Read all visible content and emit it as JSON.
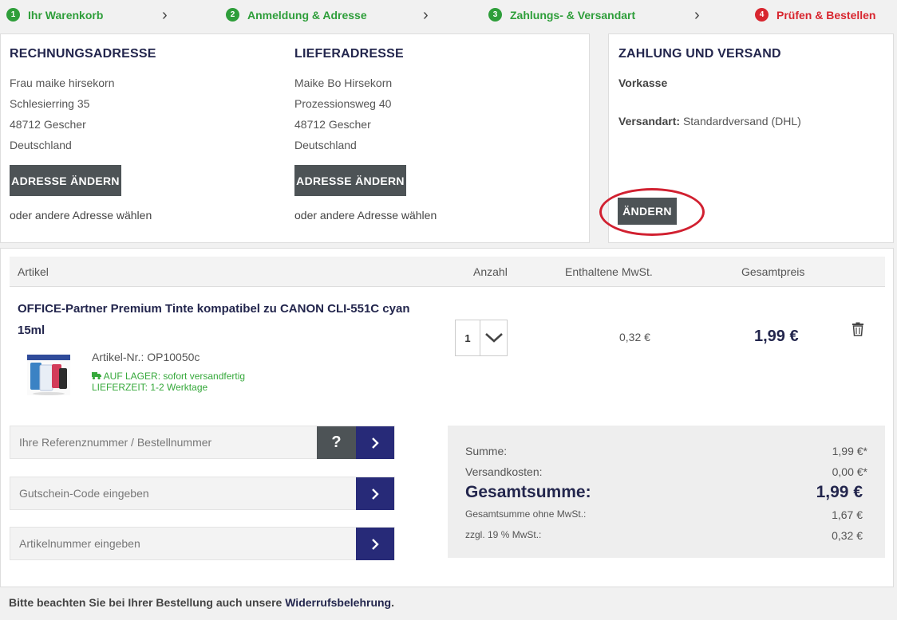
{
  "steps": [
    {
      "num": "1",
      "label": "Ihr Warenkorb"
    },
    {
      "num": "2",
      "label": "Anmeldung & Adresse"
    },
    {
      "num": "3",
      "label": "Zahlungs- & Versandart"
    },
    {
      "num": "4",
      "label": "Prüfen & Bestellen"
    }
  ],
  "billing": {
    "title": "RECHNUNGSADRESSE",
    "lines": [
      "Frau maike hirsekorn",
      "Schlesierring 35",
      "48712 Gescher",
      "Deutschland"
    ],
    "change_button": "ADRESSE ÄNDERN",
    "other_link": "oder andere Adresse wählen"
  },
  "shipping": {
    "title": "LIEFERADRESSE",
    "lines": [
      "Maike Bo Hirsekorn",
      "Prozessionsweg 40",
      "48712 Gescher",
      "Deutschland"
    ],
    "change_button": "ADRESSE ÄNDERN",
    "other_link": "oder andere Adresse wählen"
  },
  "payment": {
    "title": "ZAHLUNG UND VERSAND",
    "method": "Vorkasse",
    "shipping_label": "Versandart:",
    "shipping_value": "Standardversand (DHL)",
    "change_button": "ÄNDERN"
  },
  "table": {
    "headers": {
      "article": "Artikel",
      "qty": "Anzahl",
      "tax": "Enthaltene MwSt.",
      "total": "Gesamtpreis"
    }
  },
  "item": {
    "title": "OFFICE-Partner Premium Tinte kompatibel zu CANON CLI-551C cyan 15ml",
    "sku": "Artikel-Nr.: OP10050c",
    "stock": "AUF LAGER: sofort versandfertig",
    "delivery": "LIEFERZEIT: 1-2 Werktage",
    "qty": "1",
    "tax": "0,32 €",
    "total": "1,99 €"
  },
  "inputs": {
    "reference_placeholder": "Ihre Referenznummer / Bestellnummer",
    "help_label": "?",
    "voucher_placeholder": "Gutschein-Code eingeben",
    "article_placeholder": "Artikelnummer eingeben"
  },
  "summary": {
    "sum_label": "Summe:",
    "sum_value": "1,99 €*",
    "shipping_label": "Versandkosten:",
    "shipping_value": "0,00 €*",
    "grand_label": "Gesamtsumme:",
    "grand_value": "1,99 €",
    "net_label": "Gesamtsumme ohne MwSt.:",
    "net_value": "1,67 €",
    "vat_label": "zzgl. 19 % MwSt.:",
    "vat_value": "0,32 €"
  },
  "footer": {
    "note": "Bitte beachten Sie bei Ihrer Bestellung auch unsere",
    "link": "Widerrufsbelehrung",
    "end": "."
  },
  "colors": {
    "accent": "#272a78",
    "done": "#2e9e3a",
    "active": "#d8262f",
    "highlight": "#d12030"
  }
}
